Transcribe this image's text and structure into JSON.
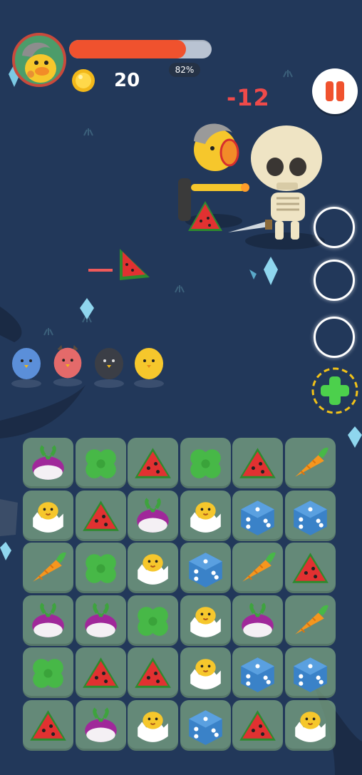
{
  "hud": {
    "health_percent_label": "82%",
    "health_fraction": 0.82,
    "coins": "20",
    "pause_icon": "pause-icon"
  },
  "battle": {
    "damage_text": "-12",
    "skill_slots": 3,
    "add_skill_icon": "plus-icon"
  },
  "party": [
    "blue-chick",
    "red-chick",
    "black-chick",
    "yellow-chick"
  ],
  "board": {
    "rows": 6,
    "cols": 6,
    "tiles": [
      [
        "turnip",
        "clover",
        "watermelon",
        "clover",
        "watermelon",
        "carrot"
      ],
      [
        "egg",
        "watermelon",
        "turnip",
        "egg",
        "dice",
        "dice"
      ],
      [
        "carrot",
        "clover",
        "egg",
        "dice",
        "carrot",
        "watermelon"
      ],
      [
        "turnip",
        "turnip",
        "clover",
        "egg",
        "turnip",
        "carrot"
      ],
      [
        "clover",
        "watermelon",
        "watermelon",
        "egg",
        "dice",
        "dice"
      ],
      [
        "watermelon",
        "turnip",
        "egg",
        "dice",
        "watermelon",
        "egg"
      ]
    ]
  },
  "colors": {
    "health": "#f0522e",
    "background": "#22385a",
    "damage": "#ef4a4a"
  }
}
